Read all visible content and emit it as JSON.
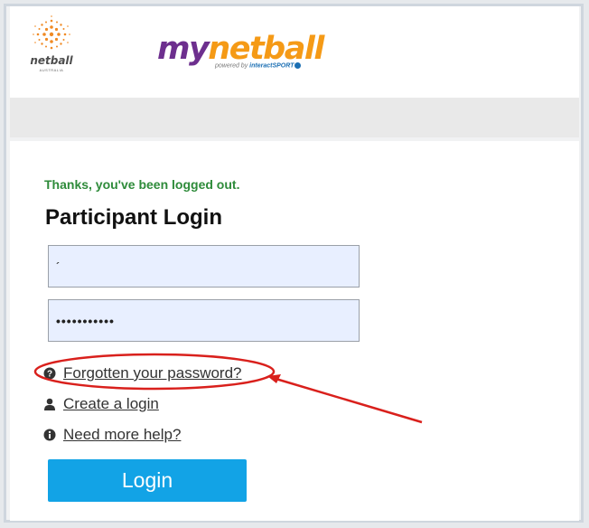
{
  "header": {
    "netball_logo": {
      "word": "netball",
      "sub": "AUSTRALIA"
    },
    "mynetball_logo": {
      "my": "my",
      "netball": "netball",
      "powered": "powered by",
      "brand": "interactSPORT"
    }
  },
  "login": {
    "notice": "Thanks, you've been logged out.",
    "title": "Participant Login",
    "username_value": "´",
    "password_value": "•••••••••••",
    "links": {
      "forgot": "Forgotten your password?",
      "create": "Create a login",
      "help": "Need more help?"
    },
    "button_label": "Login"
  },
  "colors": {
    "notice_green": "#2e8b3a",
    "button_blue": "#12a3e6",
    "annotation_red": "#d9201c",
    "brand_purple": "#6d2f8e",
    "brand_orange": "#f59a16"
  },
  "icons": {
    "forgot": "question-circle-icon",
    "create": "user-icon",
    "help": "info-circle-icon"
  }
}
